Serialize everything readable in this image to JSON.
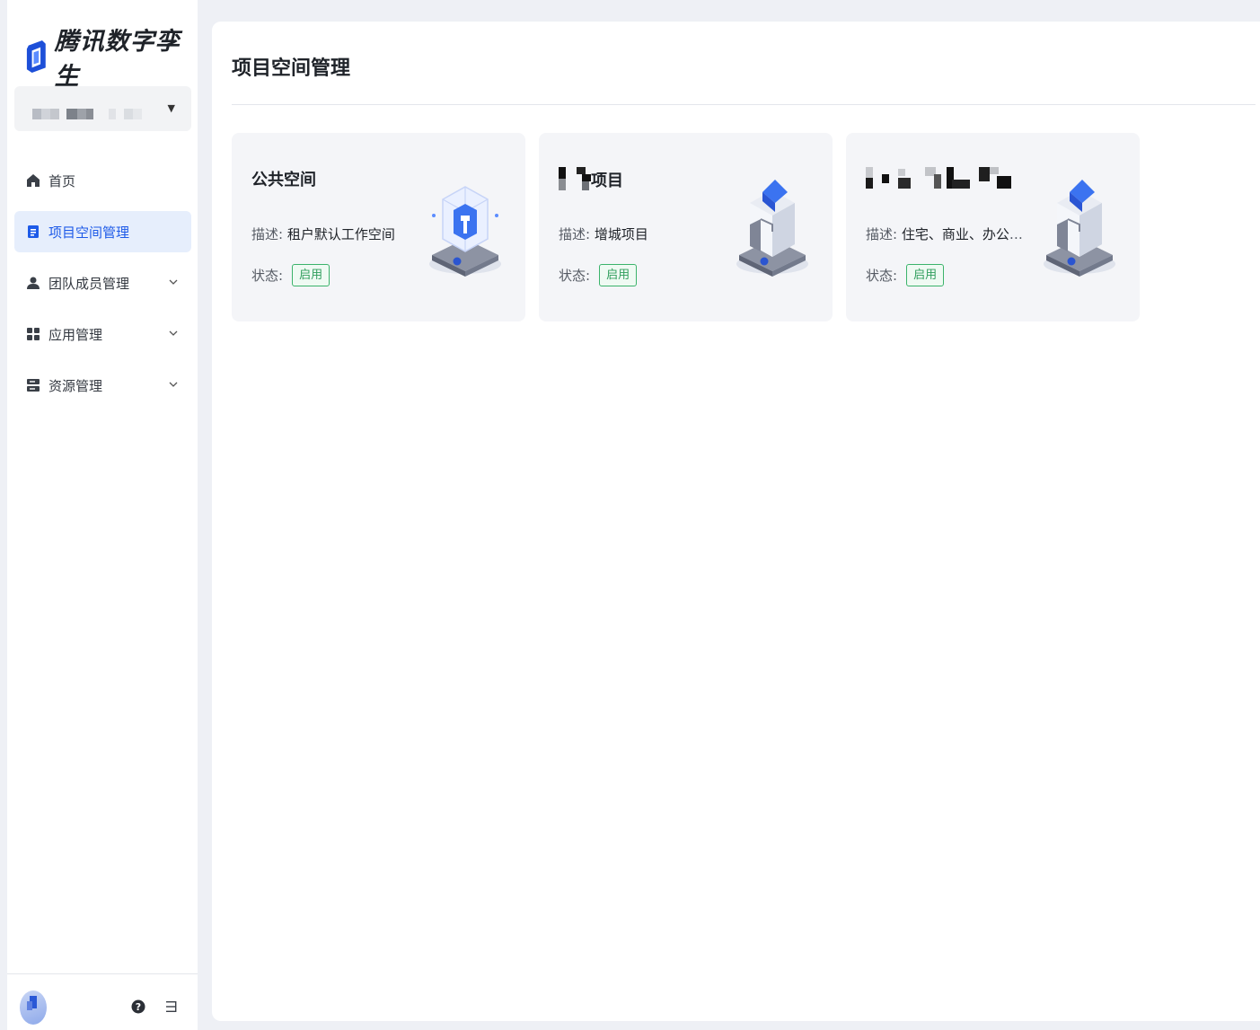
{
  "app": {
    "brand": "腾讯数字孪生"
  },
  "org_select": {
    "value_redacted": true
  },
  "nav": {
    "items": [
      {
        "key": "home",
        "label": "首页",
        "icon": "home-icon",
        "active": false,
        "expandable": false
      },
      {
        "key": "project-space",
        "label": "项目空间管理",
        "icon": "document-icon",
        "active": true,
        "expandable": false
      },
      {
        "key": "team",
        "label": "团队成员管理",
        "icon": "user-icon",
        "active": false,
        "expandable": true
      },
      {
        "key": "apps",
        "label": "应用管理",
        "icon": "grid-icon",
        "active": false,
        "expandable": true
      },
      {
        "key": "resources",
        "label": "资源管理",
        "icon": "server-icon",
        "active": false,
        "expandable": true
      }
    ]
  },
  "page": {
    "title": "项目空间管理"
  },
  "labels": {
    "desc": "描述:",
    "status": "状态:"
  },
  "cards": [
    {
      "title": "公共空间",
      "desc": "租户默认工作空间",
      "status": "启用",
      "art": "cube-frame-icon"
    },
    {
      "title": "项目",
      "title_partial_redacted": true,
      "desc": "增城项目",
      "status": "启用",
      "art": "building-block-icon"
    },
    {
      "title": "",
      "title_redacted": true,
      "desc": "住宅、商业、办公楼...",
      "status": "启用",
      "art": "building-block-icon"
    }
  ],
  "colors": {
    "accent": "#1d5ae8",
    "active_bg": "#e6eefc",
    "status_green": "#2f9e5c",
    "page_bg": "#eef0f5"
  }
}
